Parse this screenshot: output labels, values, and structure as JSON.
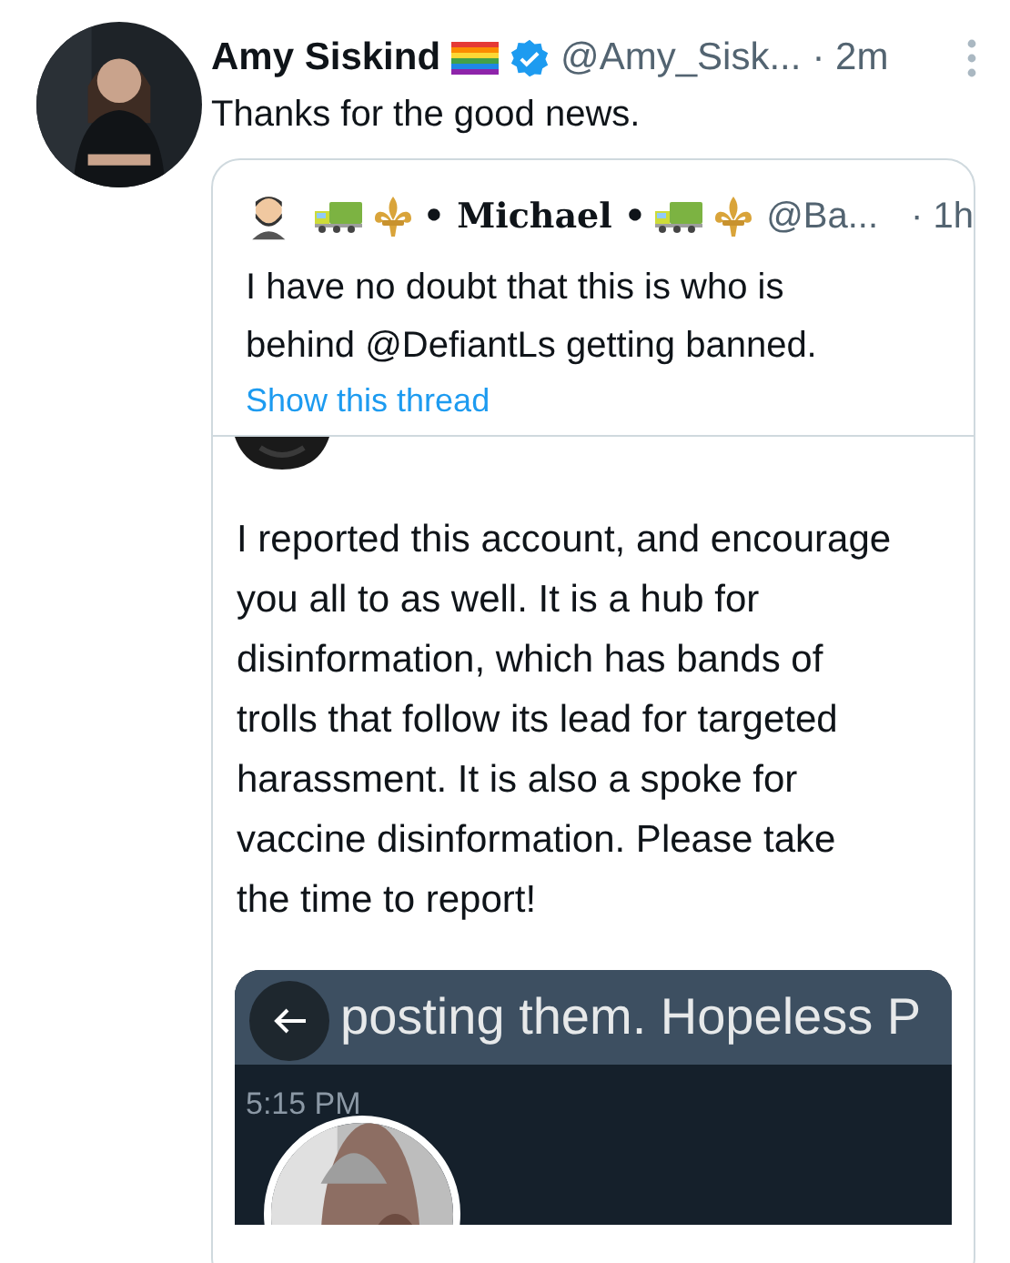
{
  "tweet": {
    "author": {
      "name": "Amy Siskind",
      "badges": [
        {
          "kind": "rainbow-flag"
        }
      ],
      "verified": true,
      "handle": "@Amy_Sisk..."
    },
    "time": "· 2m",
    "text": "Thanks for the good news.",
    "quote": {
      "author": {
        "name_parts": [
          {
            "kind": "truck"
          },
          {
            "kind": "fleur"
          },
          {
            "kind": "text",
            "text": "• Michael •"
          },
          {
            "kind": "truck"
          },
          {
            "kind": "fleur"
          }
        ],
        "handle": "@Ba..."
      },
      "time": "· 1h",
      "text": "I have no doubt that this is who is behind @DefiantLs getting banned.",
      "link": "Show this thread",
      "embedded": {
        "text": "I reported this account, and encourage you all to as well. It is a hub for disinformation, which has bands of trolls that follow its lead for targeted harassment. It is also a spoke for vaccine disinformation. Please take the time to report!",
        "media": {
          "kind": "picture",
          "caption": "posting them. Hopeless P",
          "time": "5:15 PM"
        }
      }
    }
  }
}
